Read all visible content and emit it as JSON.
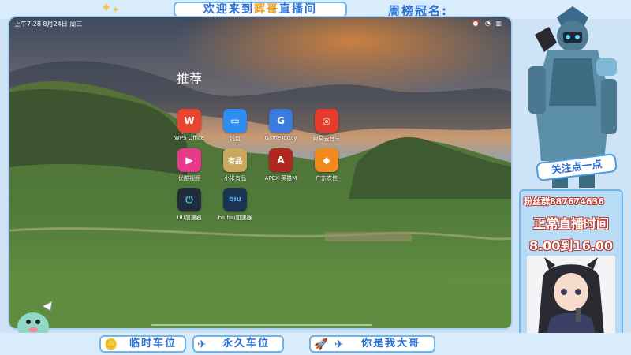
{
  "banner": {
    "title_part1": "欢迎来到",
    "title_highlight": "辉哥",
    "title_part2": "直播间",
    "rank_label": "周榜冠名:"
  },
  "status_bar": {
    "time_date": "上午7:28  8月24日 周三",
    "right_icons": "⏰ ◔ ▥"
  },
  "home": {
    "section_title": "推荐",
    "apps": [
      {
        "label": "WPS Office",
        "icon": "W",
        "color": "#e8442f"
      },
      {
        "label": "钱包",
        "icon": "▭",
        "color": "#2f8cf0"
      },
      {
        "label": "GameToday",
        "icon": "G",
        "color": "#3a7be0"
      },
      {
        "label": "网易云音乐",
        "icon": "◎",
        "color": "#e53a2c"
      },
      {
        "label": "优酷视频",
        "icon": "▶",
        "color": "#e83a8a"
      },
      {
        "label": "小米有品",
        "icon": "有品",
        "color": "#c9a85e"
      },
      {
        "label": "APEX 英雄M",
        "icon": "A",
        "color": "#b0271f"
      },
      {
        "label": "广东农信",
        "icon": "◆",
        "color": "#f08a1c"
      },
      {
        "label": "UU加速器",
        "icon": "⏻",
        "color": "#1f2b3a"
      },
      {
        "label": "biubiu加速器",
        "icon": "biu",
        "color": "#1d3350"
      }
    ]
  },
  "overlay": {
    "follow_text": "关注点一点",
    "fan_group": "粉丝群887674636",
    "live_time_title": "正常直播时间",
    "live_time_hours": "8.00到16.00"
  },
  "bottom_bar": {
    "temp_car": "临时车位",
    "permanent_car": "永久车位",
    "big_brother": "你是我大哥"
  },
  "colors": {
    "accent": "#2a6fd1",
    "border": "#6fb4ea",
    "panel": "#b9dcf6",
    "alert_red": "#c0392b"
  }
}
